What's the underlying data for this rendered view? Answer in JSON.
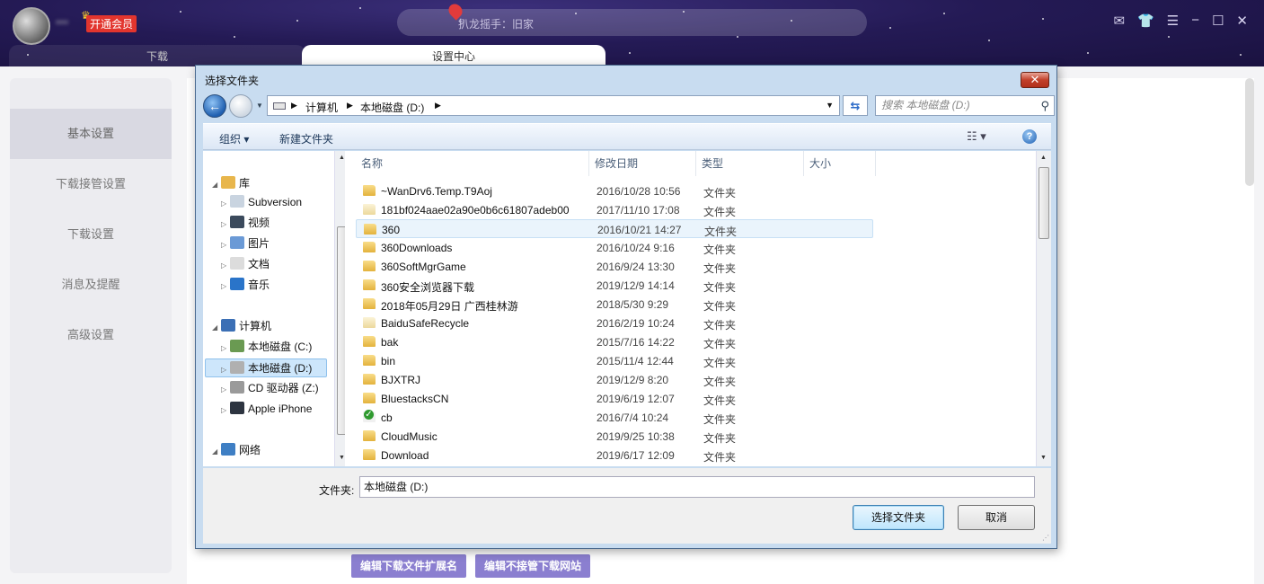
{
  "app": {
    "vip_label": "开通会员",
    "username": "***",
    "search_placeholder": "扒龙摇手：旧家",
    "tabs": [
      {
        "label": "下载"
      },
      {
        "label": "设置中心"
      }
    ],
    "sidebar": [
      {
        "label": "基本设置"
      },
      {
        "label": "下载接管设置"
      },
      {
        "label": "下载设置"
      },
      {
        "label": "消息及提醒"
      },
      {
        "label": "高级设置"
      }
    ],
    "buttons": {
      "edit_ext": "编辑下载文件扩展名",
      "edit_sites": "编辑不接管下载网站"
    },
    "colors": {
      "header_bg": "#241a55",
      "vip_red": "#e2352e",
      "purple_btn": "#8b7fd0"
    }
  },
  "dialog": {
    "title": "选择文件夹",
    "close_glyph": "✕",
    "breadcrumb": [
      "计算机",
      "本地磁盘 (D:)"
    ],
    "search_placeholder": "搜索 本地磁盘 (D:)",
    "toolbar": {
      "organize": "组织 ▾",
      "new_folder": "新建文件夹"
    },
    "tree": [
      {
        "label": "库",
        "icon": "library-icon",
        "level": 0
      },
      {
        "label": "Subversion",
        "icon": "document-library-icon",
        "level": 1
      },
      {
        "label": "视频",
        "icon": "video-icon",
        "level": 1
      },
      {
        "label": "图片",
        "icon": "picture-icon",
        "level": 1
      },
      {
        "label": "文档",
        "icon": "document-icon",
        "level": 1
      },
      {
        "label": "音乐",
        "icon": "music-icon",
        "level": 1
      },
      {
        "label": "计算机",
        "icon": "computer-icon",
        "level": 0
      },
      {
        "label": "本地磁盘 (C:)",
        "icon": "system-drive-icon",
        "level": 1
      },
      {
        "label": "本地磁盘 (D:)",
        "icon": "drive-icon",
        "level": 1,
        "selected": true
      },
      {
        "label": "CD 驱动器 (Z:)",
        "icon": "cd-drive-icon",
        "level": 1
      },
      {
        "label": "Apple iPhone",
        "icon": "phone-icon",
        "level": 1
      },
      {
        "label": "网络",
        "icon": "network-icon",
        "level": 0
      }
    ],
    "columns": [
      "名称",
      "修改日期",
      "类型",
      "大小"
    ],
    "files": [
      {
        "name": "~WanDrv6.Temp.T9Aoj",
        "date": "2016/10/28 10:56",
        "type": "文件夹",
        "icon": "folder"
      },
      {
        "name": "181bf024aae02a90e0b6c61807adeb00",
        "date": "2017/11/10 17:08",
        "type": "文件夹",
        "icon": "plain"
      },
      {
        "name": "360",
        "date": "2016/10/21 14:27",
        "type": "文件夹",
        "icon": "folder",
        "highlight": true
      },
      {
        "name": "360Downloads",
        "date": "2016/10/24 9:16",
        "type": "文件夹",
        "icon": "folder"
      },
      {
        "name": "360SoftMgrGame",
        "date": "2016/9/24 13:30",
        "type": "文件夹",
        "icon": "folder"
      },
      {
        "name": "360安全浏览器下载",
        "date": "2019/12/9 14:14",
        "type": "文件夹",
        "icon": "folder"
      },
      {
        "name": "2018年05月29日 广西桂林游",
        "date": "2018/5/30 9:29",
        "type": "文件夹",
        "icon": "folder"
      },
      {
        "name": "BaiduSafeRecycle",
        "date": "2016/2/19 10:24",
        "type": "文件夹",
        "icon": "plain"
      },
      {
        "name": "bak",
        "date": "2015/7/16 14:22",
        "type": "文件夹",
        "icon": "folder"
      },
      {
        "name": "bin",
        "date": "2015/11/4 12:44",
        "type": "文件夹",
        "icon": "folder"
      },
      {
        "name": "BJXTRJ",
        "date": "2019/12/9 8:20",
        "type": "文件夹",
        "icon": "folder"
      },
      {
        "name": "BluestacksCN",
        "date": "2019/6/19 12:07",
        "type": "文件夹",
        "icon": "folder"
      },
      {
        "name": "cb",
        "date": "2016/7/4 10:24",
        "type": "文件夹",
        "icon": "green"
      },
      {
        "name": "CloudMusic",
        "date": "2019/9/25 10:38",
        "type": "文件夹",
        "icon": "folder"
      },
      {
        "name": "Download",
        "date": "2019/6/17 12:09",
        "type": "文件夹",
        "icon": "folder"
      }
    ],
    "folder_label": "文件夹:",
    "folder_value": "本地磁盘 (D:)",
    "select_button": "选择文件夹",
    "cancel_button": "取消"
  }
}
